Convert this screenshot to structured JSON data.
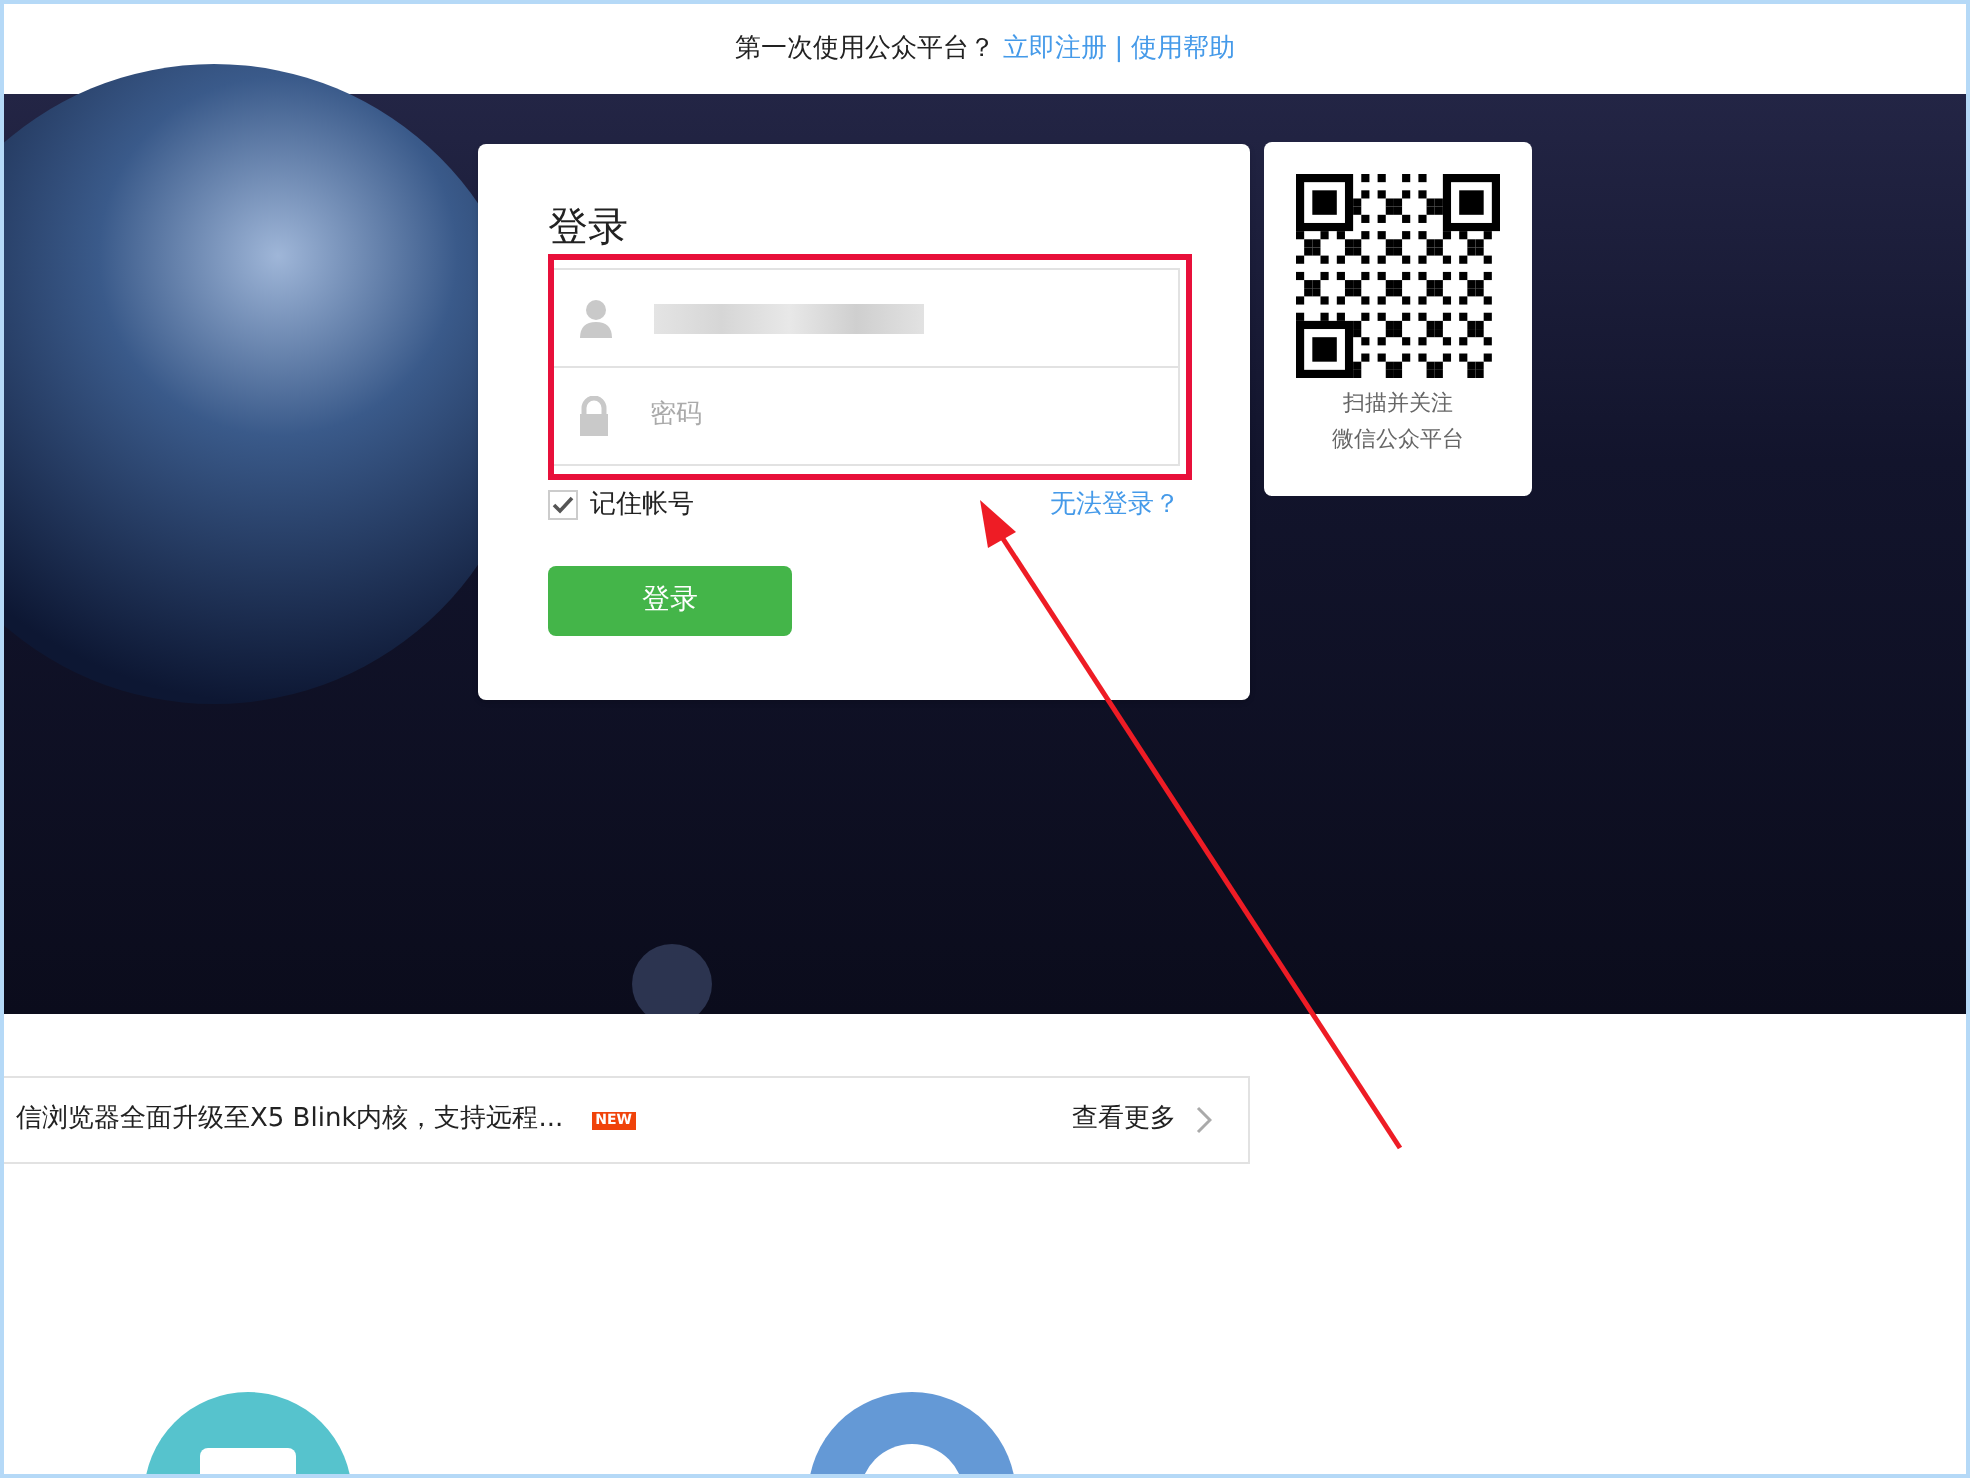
{
  "top_bar": {
    "question": "第一次使用公众平台？",
    "register_link": "立即注册",
    "separator": "|",
    "help_link": "使用帮助"
  },
  "login": {
    "title": "登录",
    "password": {
      "placeholder": "密码"
    },
    "remember": {
      "label": "记住帐号",
      "checked": true
    },
    "forgot_link": "无法登录？",
    "submit": "登录"
  },
  "qr": {
    "caption_lines": [
      "扫描并关注",
      "微信公众平台"
    ]
  },
  "news": {
    "headline": "信浏览器全面升级至X5 Blink内核，支持远程...",
    "badge": "NEW",
    "more": "查看更多"
  }
}
